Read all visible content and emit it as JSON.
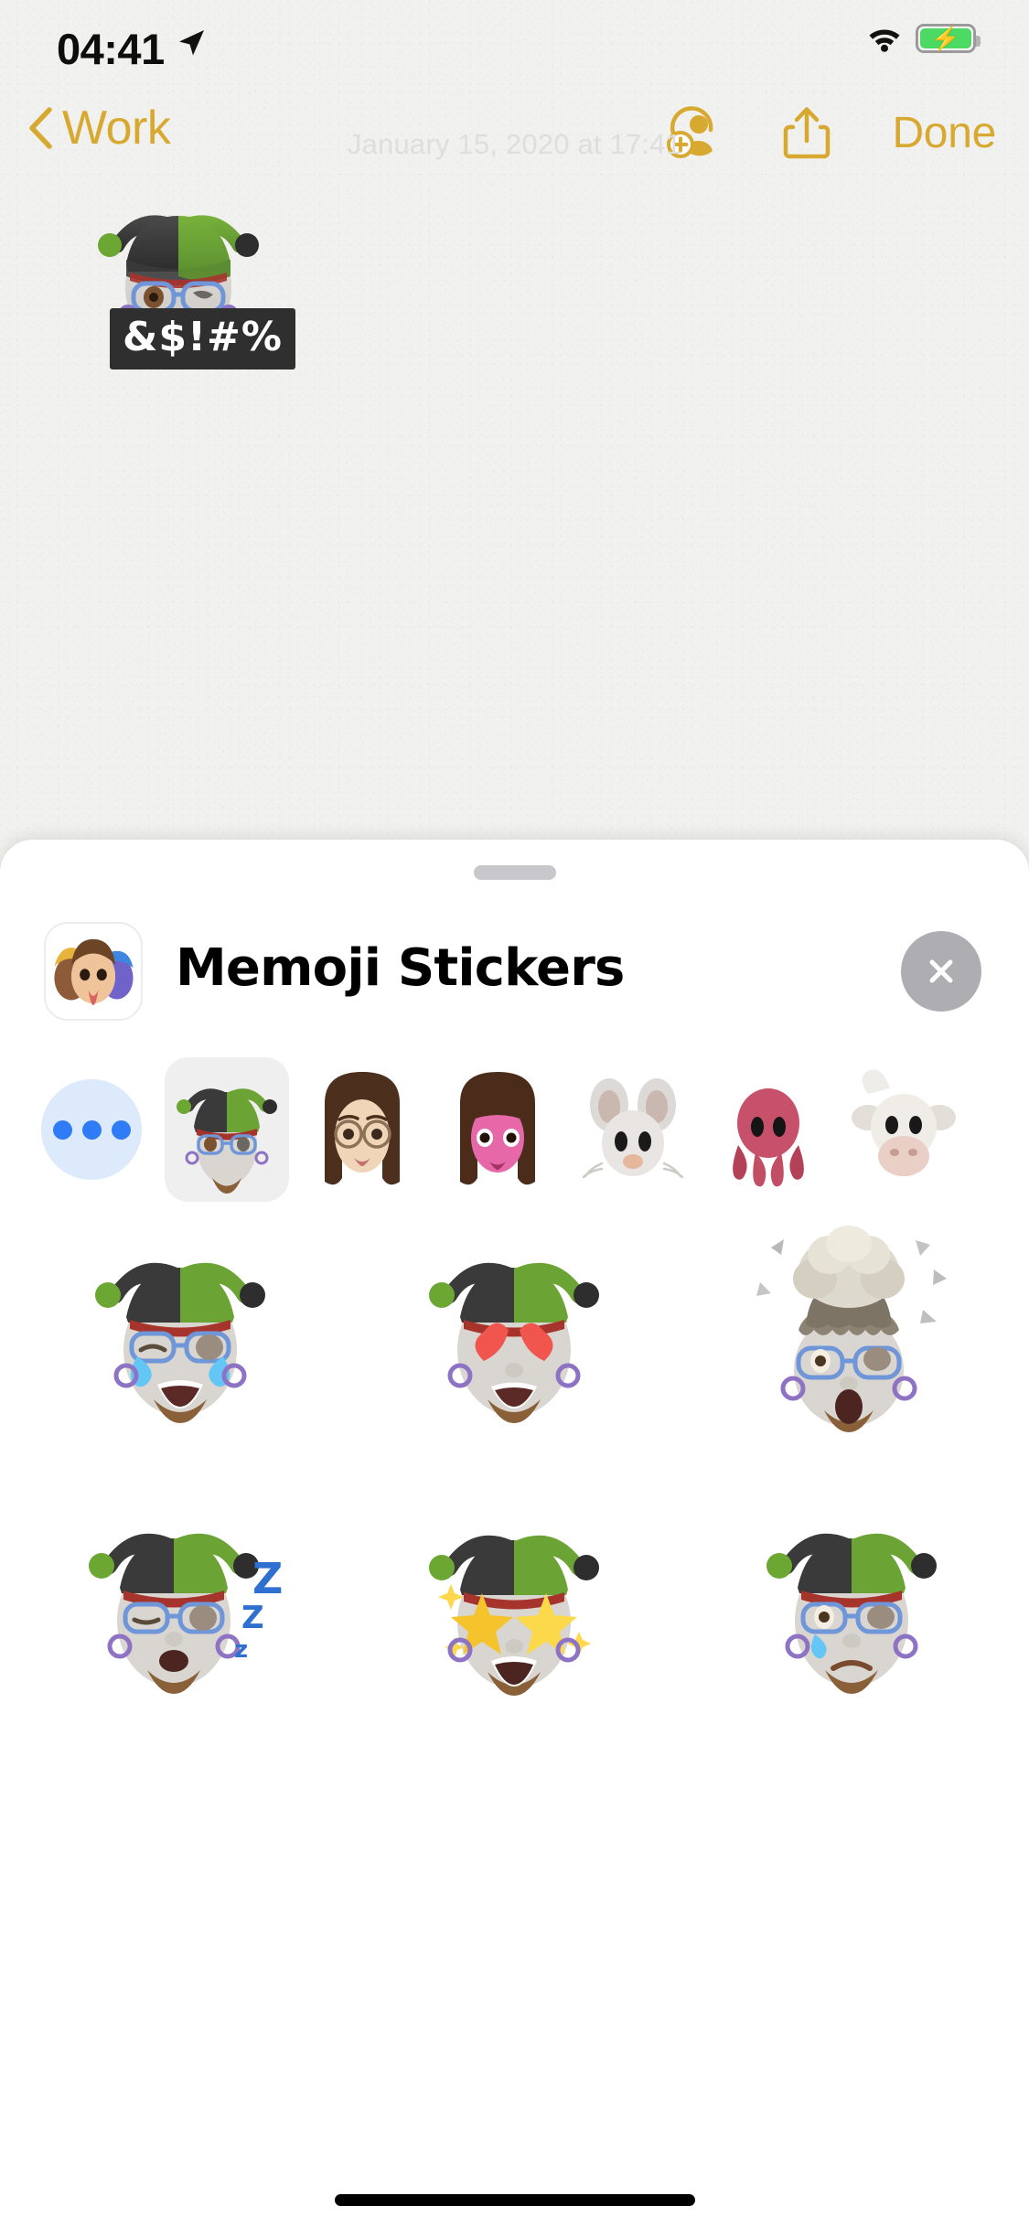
{
  "status_bar": {
    "time": "04:41",
    "location_icon": "location-arrow-icon",
    "wifi_icon": "wifi-icon",
    "battery_icon": "battery-charging-icon",
    "battery_charging": true,
    "battery_color": "#4cd964"
  },
  "nav_bar": {
    "back_label": "Work",
    "back_icon": "chevron-left-icon",
    "add_person_icon": "add-person-icon",
    "share_icon": "share-icon",
    "done_label": "Done",
    "accent_color": "#d8a930"
  },
  "note": {
    "date": "January 15, 2020 at 17:41",
    "sticker_name": "memoji-jester-cursing",
    "censored_text": "&$!#%",
    "add_button_icon": "plus-icon"
  },
  "sheet": {
    "grabber": "sheet-grabber",
    "app_icon": "memoji-stickers-app-icon",
    "title": "Memoji Stickers",
    "close_icon": "close-x-icon",
    "close_bg": "#aeaeb2",
    "characters": [
      {
        "name": "more-button",
        "label": "...",
        "selected": false,
        "type": "more"
      },
      {
        "name": "memoji-jester",
        "label": "Jester Memoji",
        "selected": true,
        "type": "memoji"
      },
      {
        "name": "memoji-woman-glasses",
        "label": "Woman w/ Glasses",
        "selected": false,
        "type": "memoji"
      },
      {
        "name": "memoji-girl-pink",
        "label": "Pink Face Girl",
        "selected": false,
        "type": "memoji"
      },
      {
        "name": "animoji-mouse",
        "label": "Mouse",
        "selected": false,
        "type": "animoji"
      },
      {
        "name": "animoji-octopus",
        "label": "Octopus",
        "selected": false,
        "type": "animoji"
      },
      {
        "name": "animoji-cow",
        "label": "Cow",
        "selected": false,
        "type": "animoji"
      }
    ],
    "stickers": [
      {
        "name": "sticker-laughing-crying",
        "label": "Laughing with Tears"
      },
      {
        "name": "sticker-heart-eyes",
        "label": "Heart Eyes"
      },
      {
        "name": "sticker-mind-blown",
        "label": "Mind Blown"
      },
      {
        "name": "sticker-sleeping",
        "label": "Sleeping Zzz"
      },
      {
        "name": "sticker-star-struck",
        "label": "Star Struck"
      },
      {
        "name": "sticker-sad-tear",
        "label": "Sad with Tear"
      }
    ]
  },
  "home_indicator": "home-indicator"
}
